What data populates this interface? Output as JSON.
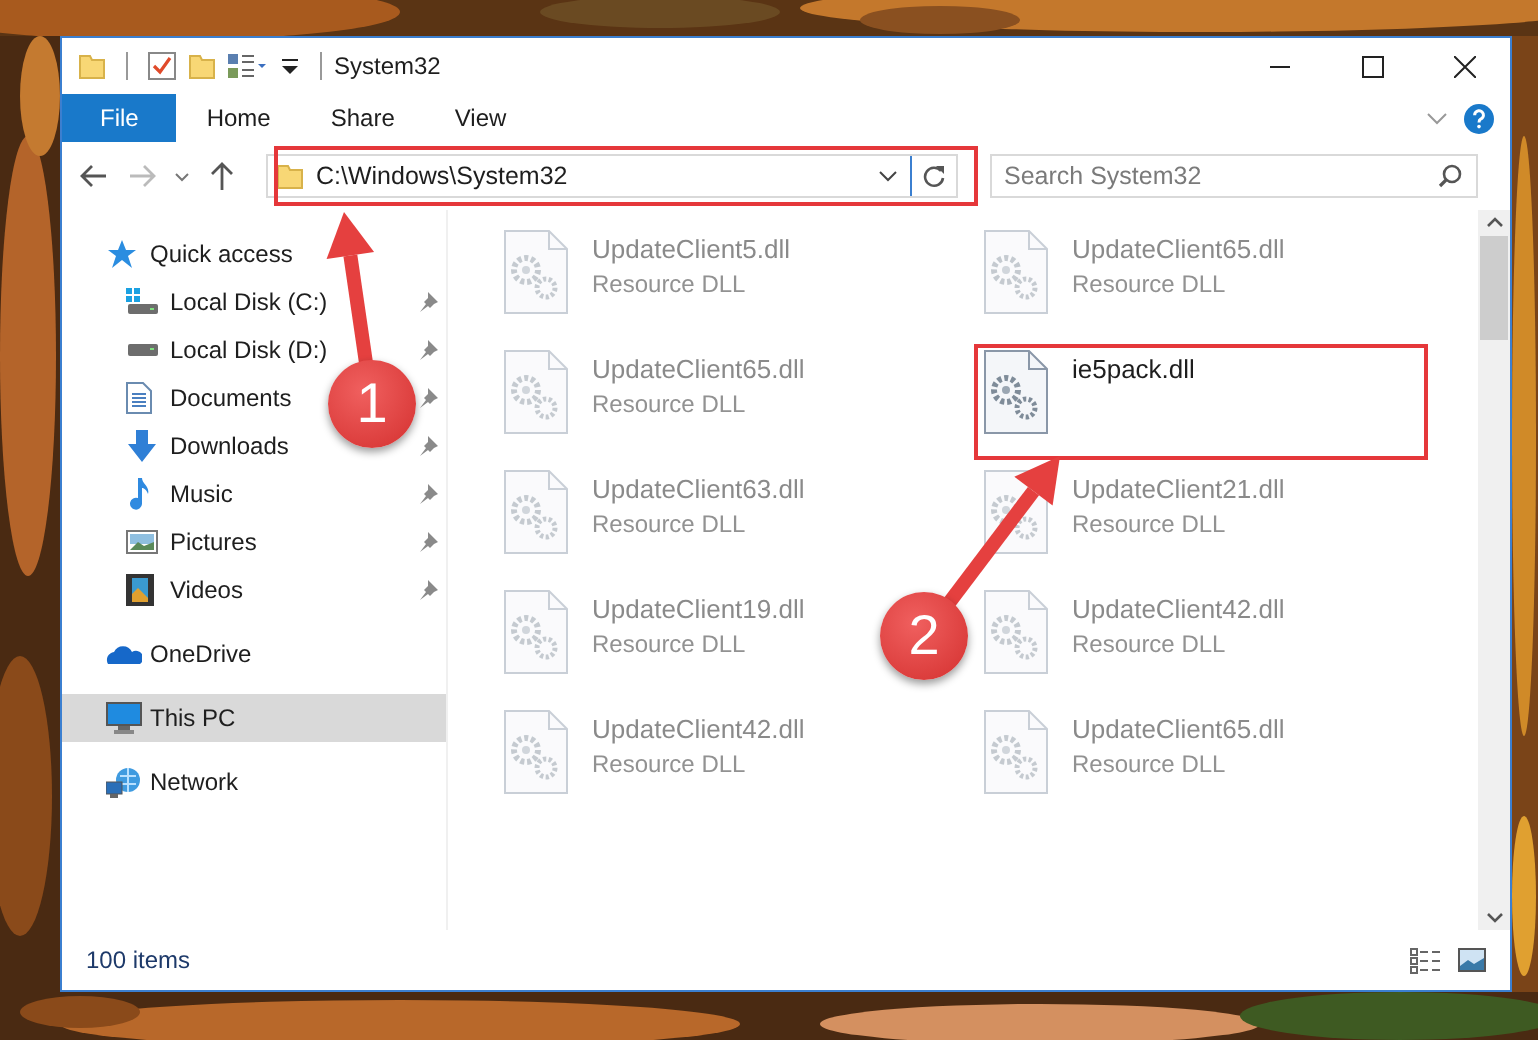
{
  "window": {
    "title": "System32"
  },
  "ribbon_tabs": [
    {
      "label": "File",
      "kind": "file"
    },
    {
      "label": "Home",
      "kind": "tab"
    },
    {
      "label": "Share",
      "kind": "tab"
    },
    {
      "label": "View",
      "kind": "tab"
    }
  ],
  "address": {
    "path": "C:\\Windows\\System32"
  },
  "search": {
    "placeholder": "Search System32"
  },
  "nav": [
    {
      "label": "Quick access",
      "kind": "star",
      "selected": false,
      "pinned": false,
      "children": [
        {
          "label": "Local Disk (C:)",
          "kind": "system-drive",
          "selected": false,
          "pinned": true
        },
        {
          "label": "Local Disk (D:)",
          "kind": "drive",
          "selected": false,
          "pinned": true
        },
        {
          "label": "Documents",
          "kind": "document",
          "selected": false,
          "pinned": true
        },
        {
          "label": "Downloads",
          "kind": "download",
          "selected": false,
          "pinned": true
        },
        {
          "label": "Music",
          "kind": "music",
          "selected": false,
          "pinned": true
        },
        {
          "label": "Pictures",
          "kind": "pictures",
          "selected": false,
          "pinned": true
        },
        {
          "label": "Videos",
          "kind": "video",
          "selected": false,
          "pinned": true
        }
      ]
    },
    {
      "label": "OneDrive",
      "kind": "cloud",
      "selected": false,
      "pinned": false
    },
    {
      "label": "This PC",
      "kind": "computer",
      "selected": true,
      "pinned": false
    },
    {
      "label": "Network",
      "kind": "network",
      "selected": false,
      "pinned": false
    }
  ],
  "files": [
    {
      "name": "UpdateClient5.dll",
      "type": "Resource DLL",
      "blurred": true
    },
    {
      "name": "UpdateClient65.dll",
      "type": "Resource DLL",
      "blurred": true
    },
    {
      "name": "UpdateClient65.dll",
      "type": "Resource DLL",
      "blurred": true
    },
    {
      "name": "ie5pack.dll",
      "blurred": false
    },
    {
      "name": "UpdateClient63.dll",
      "type": "Resource DLL",
      "blurred": true
    },
    {
      "name": "UpdateClient21.dll",
      "type": "Resource DLL",
      "blurred": true
    },
    {
      "name": "UpdateClient19.dll",
      "type": "Resource DLL",
      "blurred": true
    },
    {
      "name": "UpdateClient42.dll",
      "type": "Resource DLL",
      "blurred": true
    },
    {
      "name": "UpdateClient42.dll",
      "type": "Resource DLL",
      "blurred": true
    },
    {
      "name": "UpdateClient65.dll",
      "type": "Resource DLL",
      "blurred": true
    }
  ],
  "status_bar": {
    "count": "100 items"
  },
  "annotations": [
    {
      "number": "1"
    },
    {
      "number": "2"
    }
  ]
}
